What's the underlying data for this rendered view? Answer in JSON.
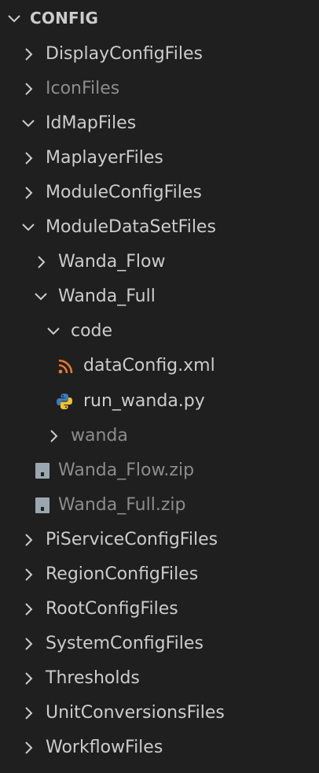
{
  "explorer": {
    "root_label": "CONFIG",
    "items": [
      {
        "label": "DisplayConfigFiles",
        "type": "folder",
        "expanded": false,
        "dim": false
      },
      {
        "label": "IconFiles",
        "type": "folder",
        "expanded": false,
        "dim": true
      },
      {
        "label": "IdMapFiles",
        "type": "folder",
        "expanded": true,
        "dim": false
      },
      {
        "label": "MaplayerFiles",
        "type": "folder",
        "expanded": false,
        "dim": false
      },
      {
        "label": "ModuleConfigFiles",
        "type": "folder",
        "expanded": false,
        "dim": false
      },
      {
        "label": "ModuleDataSetFiles",
        "type": "folder",
        "expanded": true,
        "dim": false
      },
      {
        "label": "Wanda_Flow",
        "type": "folder",
        "expanded": false,
        "dim": false
      },
      {
        "label": "Wanda_Full",
        "type": "folder",
        "expanded": true,
        "dim": false
      },
      {
        "label": "code",
        "type": "folder",
        "expanded": true,
        "dim": false
      },
      {
        "label": "dataConfig.xml",
        "type": "file",
        "icon": "rss-feed-icon",
        "dim": false
      },
      {
        "label": "run_wanda.py",
        "type": "file",
        "icon": "python-icon",
        "dim": false
      },
      {
        "label": "wanda",
        "type": "folder",
        "expanded": false,
        "dim": true
      },
      {
        "label": "Wanda_Flow.zip",
        "type": "file",
        "icon": "zip-archive-icon",
        "dim": true
      },
      {
        "label": "Wanda_Full.zip",
        "type": "file",
        "icon": "zip-archive-icon",
        "dim": true
      },
      {
        "label": "PiServiceConfigFiles",
        "type": "folder",
        "expanded": false,
        "dim": false
      },
      {
        "label": "RegionConfigFiles",
        "type": "folder",
        "expanded": false,
        "dim": false
      },
      {
        "label": "RootConfigFiles",
        "type": "folder",
        "expanded": false,
        "dim": false
      },
      {
        "label": "SystemConfigFiles",
        "type": "folder",
        "expanded": false,
        "dim": false
      },
      {
        "label": "Thresholds",
        "type": "folder",
        "expanded": false,
        "dim": false
      },
      {
        "label": "UnitConversionsFiles",
        "type": "folder",
        "expanded": false,
        "dim": false
      },
      {
        "label": "WorkflowFiles",
        "type": "folder",
        "expanded": false,
        "dim": false
      }
    ]
  },
  "colors": {
    "background": "#1f1f1f",
    "text": "#cccccc",
    "text_dim": "#8c8c8c",
    "rss_icon": "#e37933",
    "python_icon_blue": "#3b7bbf",
    "python_icon_yellow": "#f1c232",
    "zip_icon": "#9aa7b0"
  }
}
